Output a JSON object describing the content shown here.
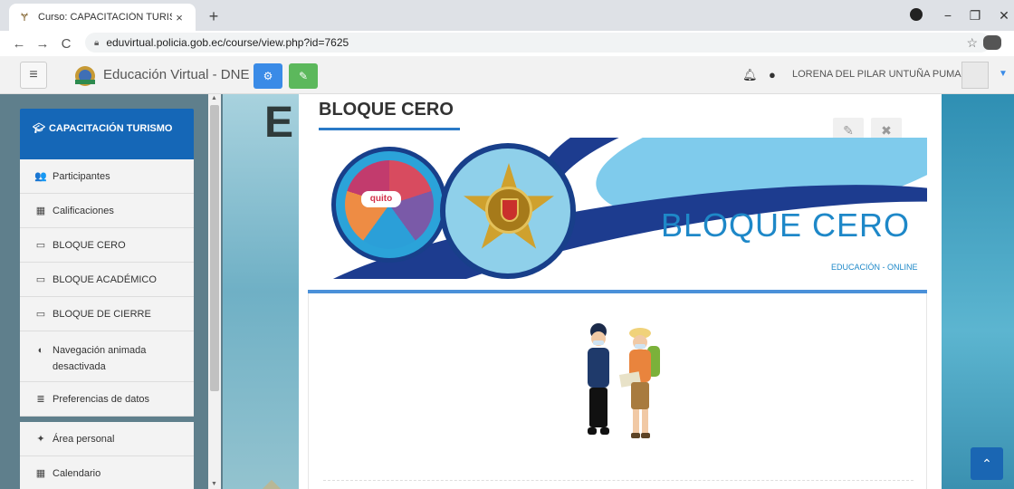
{
  "browser": {
    "tab_title": "Curso: CAPACITACIÓN TURISMO",
    "tab_close": "×",
    "new_tab": "+",
    "url": "eduvirtual.policia.gob.ec/course/view.php?id=7625",
    "back": "←",
    "forward": "→",
    "reload": "C",
    "star": "☆",
    "minimize": "−",
    "restore": "❐",
    "close": "✕"
  },
  "navbar": {
    "menu_icon": "≡",
    "site_name": "Educación Virtual - DNE",
    "user_name": "LORENA DEL PILAR UNTUÑA PUMA"
  },
  "drawer": {
    "course_title": "CAPACITACIÓN TURISMO",
    "items": [
      {
        "label": "Participantes",
        "icon": "users-icon",
        "glyph": "👥"
      },
      {
        "label": "Calificaciones",
        "icon": "table-icon",
        "glyph": "▦"
      },
      {
        "label": "BLOQUE CERO",
        "icon": "folder-icon",
        "glyph": "▭"
      },
      {
        "label": "BLOQUE ACADÉMICO",
        "icon": "folder-icon",
        "glyph": "▭"
      },
      {
        "label": "BLOQUE DE CIERRE",
        "icon": "folder-icon",
        "glyph": "▭"
      },
      {
        "label": "Navegación animada desactivada",
        "icon": "toggle-icon",
        "glyph": "◐"
      },
      {
        "label": "Preferencias de datos",
        "icon": "database-icon",
        "glyph": "≣"
      }
    ],
    "secondary_items": [
      {
        "label": "Área personal",
        "icon": "dashboard-icon",
        "glyph": "✦"
      },
      {
        "label": "Calendario",
        "icon": "calendar-icon",
        "glyph": "▦"
      }
    ]
  },
  "section": {
    "title": "BLOQUE CERO",
    "banner_title": "BLOQUE CERO",
    "banner_subtitle": "EDUCACIÓN - ONLINE",
    "quito_logo_text": "quito"
  },
  "colors": {
    "accent": "#1567b7",
    "green": "#5cb85c",
    "banner_blue": "#1e88c8",
    "banner_navy": "#1d3c8f"
  }
}
